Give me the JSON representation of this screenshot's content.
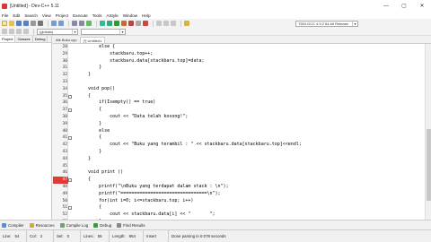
{
  "window": {
    "title": "[Untitled] - Dev-C++ 5.11",
    "minimize_glyph": "—",
    "maximize_glyph": "▢",
    "close_glyph": "✕"
  },
  "menu": [
    "File",
    "Edit",
    "Search",
    "View",
    "Project",
    "Execute",
    "Tools",
    "AStyle",
    "Window",
    "Help"
  ],
  "toolbar": {
    "compiler_combo": "TDM-GCC 4.9.2 64-bit Release",
    "globals_combo": "(globals)"
  },
  "left_panel": {
    "tabs": [
      "Project",
      "Classes",
      "Debug"
    ]
  },
  "editor_tabs": [
    "tilik Buku.cpp",
    "[*] Untitled1"
  ],
  "code_lines": [
    {
      "num": "28",
      "text": "        else {",
      "fold": "",
      "err": false
    },
    {
      "num": "29",
      "text": "            stackbaru.top++;",
      "fold": "",
      "err": false
    },
    {
      "num": "30",
      "text": "            stackbaru.data[stackbaru.top]=data;",
      "fold": "",
      "err": false
    },
    {
      "num": "31",
      "text": "        }",
      "fold": "",
      "err": false
    },
    {
      "num": "32",
      "text": "    }",
      "fold": "",
      "err": false
    },
    {
      "num": "33",
      "text": "",
      "fold": "",
      "err": false
    },
    {
      "num": "34",
      "text": "    void pop()",
      "fold": "",
      "err": false
    },
    {
      "num": "35",
      "text": "    {",
      "fold": "-",
      "err": false
    },
    {
      "num": "36",
      "text": "        if(Isempty() == true)",
      "fold": "",
      "err": false
    },
    {
      "num": "37",
      "text": "        {",
      "fold": "-",
      "err": false
    },
    {
      "num": "38",
      "text": "            cout << \"Data telah kosong!\";",
      "fold": "",
      "err": false
    },
    {
      "num": "39",
      "text": "        }",
      "fold": "",
      "err": false
    },
    {
      "num": "40",
      "text": "        else",
      "fold": "",
      "err": false
    },
    {
      "num": "41",
      "text": "        {",
      "fold": "-",
      "err": false
    },
    {
      "num": "42",
      "text": "            cout << \"Buku yang terambil : \" << stackbaru.data[stackbaru.top]<<endl;",
      "fold": "",
      "err": false
    },
    {
      "num": "43",
      "text": "        }",
      "fold": "",
      "err": false
    },
    {
      "num": "44",
      "text": "    }",
      "fold": "",
      "err": false
    },
    {
      "num": "45",
      "text": "",
      "fold": "",
      "err": false
    },
    {
      "num": "46",
      "text": "    void print ()",
      "fold": "",
      "err": false
    },
    {
      "num": "47",
      "text": "    {",
      "fold": "-",
      "err": true
    },
    {
      "num": "48",
      "text": "        printf(\"\\nBuku yang terdapat dalam stack : \\n\");",
      "fold": "",
      "err": false
    },
    {
      "num": "49",
      "text": "        printf(\"================================\\n\");",
      "fold": "",
      "err": false
    },
    {
      "num": "50",
      "text": "        for(int i=0; i<=stackbaru.top; i++)",
      "fold": "",
      "err": false
    },
    {
      "num": "51",
      "text": "        {",
      "fold": "-",
      "err": false
    },
    {
      "num": "52",
      "text": "            cout << stackbaru.data[i] << \"       \";",
      "fold": "",
      "err": false
    },
    {
      "num": "53",
      "text": "        }",
      "fold": "",
      "err": false
    },
    {
      "num": "54",
      "text": "    }",
      "fold": "",
      "err": true
    }
  ],
  "bottom_tabs": [
    "Compiler",
    "Resources",
    "Compile Log",
    "Debug",
    "Find Results"
  ],
  "status": {
    "line_label": "Line:",
    "line_val": "54",
    "col_label": "Col:",
    "col_val": "2",
    "sel_label": "Sel:",
    "sel_val": "0",
    "lines_label": "Lines:",
    "lines_val": "55",
    "length_label": "Length:",
    "length_val": "864",
    "mode": "Insert",
    "message": "Done parsing in 0.078 seconds"
  },
  "colors": {
    "error_marker": "#e53935",
    "string": "#0000c8",
    "accent": "#1e6fd9"
  }
}
